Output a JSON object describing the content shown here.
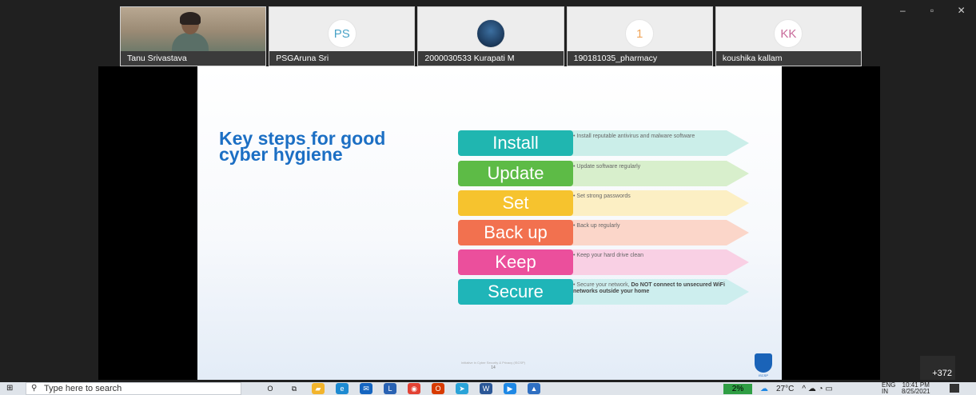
{
  "meeting": {
    "participants": [
      {
        "name": "Tanu Srivastava",
        "type": "video"
      },
      {
        "name": "PSGAruna Sri",
        "type": "initials",
        "initials": "PS",
        "color": "#4aa3c7"
      },
      {
        "name": "2000030533 Kurapati  M",
        "type": "photo"
      },
      {
        "name": "190181035_pharmacy",
        "type": "initials",
        "initials": "1",
        "color": "#f0a55a"
      },
      {
        "name": "koushika kallam",
        "type": "initials",
        "initials": "KK",
        "color": "#c86a9a"
      }
    ],
    "window_controls": {
      "minimize": "–",
      "restore": "▫",
      "close": "✕"
    },
    "more_participants": "+372"
  },
  "slide": {
    "title": "Key steps for good cyber hygiene",
    "steps": [
      {
        "label": "Install",
        "color": "#20b6b0",
        "arrow": "#cbeee9",
        "desc": "Install reputable antivirus and malware software"
      },
      {
        "label": "Update",
        "color": "#5dbb46",
        "arrow": "#d8efcc",
        "desc": "Update software regularly"
      },
      {
        "label": "Set",
        "color": "#f6c32e",
        "arrow": "#fcefc4",
        "desc": "Set strong passwords"
      },
      {
        "label": "Back up",
        "color": "#f2714f",
        "arrow": "#fbd6c9",
        "desc": "Back up regularly"
      },
      {
        "label": "Keep",
        "color": "#eb4f9c",
        "arrow": "#f9d0e4",
        "desc": "Keep your hard drive clean"
      },
      {
        "label": "Secure",
        "color": "#1fb5b8",
        "arrow": "#cdeeee",
        "desc_pre": "Secure your  network, ",
        "desc_bold": "Do NOT connect to unsecured WiFi networks outside your home"
      }
    ],
    "footer_line1": "Initiative in Cyber Security & Privacy (ISCSP)",
    "page_number": "14",
    "logo_text": "ISCSP"
  },
  "taskbar": {
    "search_placeholder": "Type here to search",
    "battery": "2%",
    "weather": "27°C",
    "tray_icons": "^ ☁ ◔ ▭",
    "lang_top": "ENG",
    "lang_bottom": "IN",
    "time": "10:41 PM",
    "date": "8/25/2021",
    "apps": [
      {
        "name": "cortana-icon",
        "glyph": "O",
        "color": "#1b1b1b"
      },
      {
        "name": "task-view-icon",
        "glyph": "⧉",
        "color": "#1b1b1b"
      },
      {
        "name": "file-explorer-icon",
        "glyph": "▰",
        "color": "#f2b42c"
      },
      {
        "name": "edge-icon",
        "glyph": "e",
        "color": "#1d8ad1"
      },
      {
        "name": "mail-icon",
        "glyph": "✉",
        "color": "#1565c0"
      },
      {
        "name": "teams-icon",
        "glyph": "L",
        "color": "#2962b3"
      },
      {
        "name": "chrome-icon",
        "glyph": "◉",
        "color": "#e34133"
      },
      {
        "name": "office-icon",
        "glyph": "O",
        "color": "#d83b01"
      },
      {
        "name": "telegram-icon",
        "glyph": "➤",
        "color": "#2aa3d8"
      },
      {
        "name": "word-icon",
        "glyph": "W",
        "color": "#2b5797"
      },
      {
        "name": "meeting-app-icon",
        "glyph": "▶",
        "color": "#1e88e5"
      },
      {
        "name": "photos-icon",
        "glyph": "▲",
        "color": "#2f6fc2"
      }
    ]
  }
}
